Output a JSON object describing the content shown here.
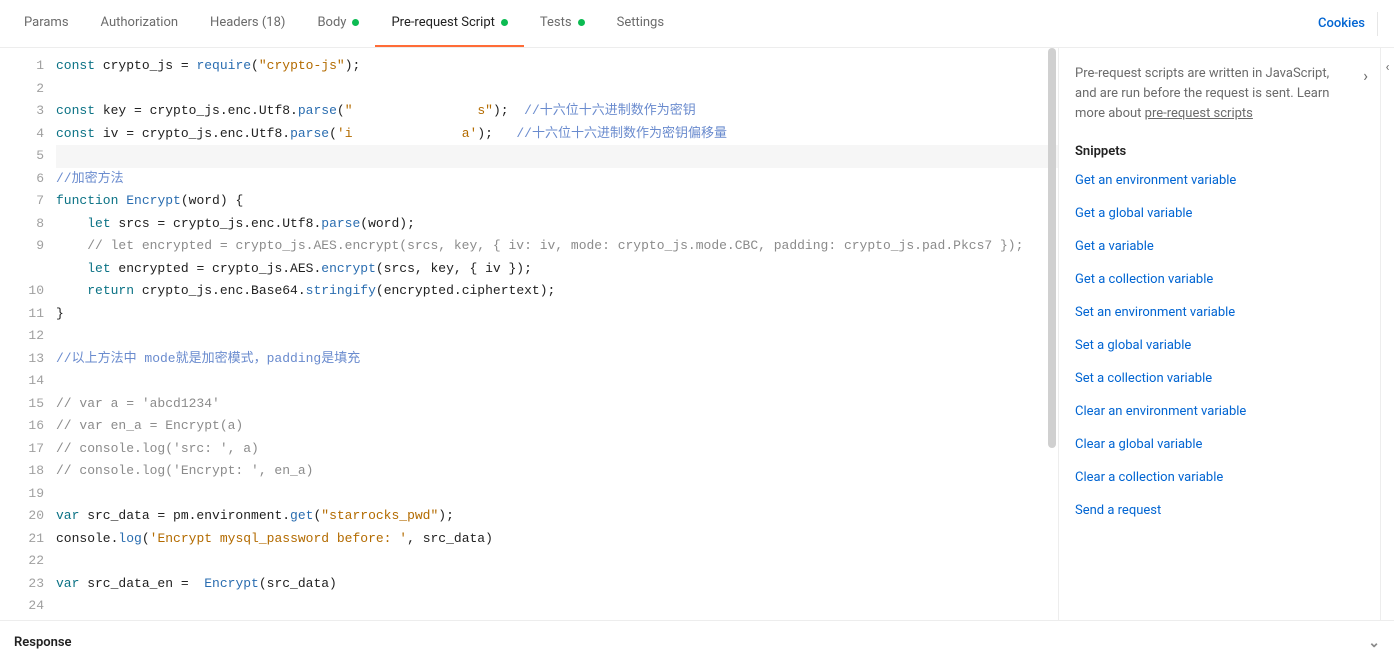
{
  "tabs": {
    "params": "Params",
    "authorization": "Authorization",
    "headers": "Headers (18)",
    "body": "Body",
    "prerequest": "Pre-request Script",
    "tests": "Tests",
    "settings": "Settings"
  },
  "cookies_label": "Cookies",
  "code": {
    "lines": [
      {
        "n": 1,
        "segs": [
          {
            "t": "const",
            "c": "kw"
          },
          {
            "t": " crypto_js = "
          },
          {
            "t": "require",
            "c": "fn"
          },
          {
            "t": "("
          },
          {
            "t": "\"crypto-js\"",
            "c": "str"
          },
          {
            "t": ");"
          }
        ]
      },
      {
        "n": 2,
        "segs": []
      },
      {
        "n": 3,
        "segs": [
          {
            "t": "const",
            "c": "kw"
          },
          {
            "t": " key = crypto_js.enc.Utf8."
          },
          {
            "t": "parse",
            "c": "fn"
          },
          {
            "t": "("
          },
          {
            "t": "\"",
            "c": "str"
          },
          {
            "t": "                s\"",
            "c": "str"
          },
          {
            "t": ");  "
          },
          {
            "t": "//十六位十六进制数作为密钥",
            "c": "cmt-cn"
          }
        ]
      },
      {
        "n": 4,
        "segs": [
          {
            "t": "const",
            "c": "kw"
          },
          {
            "t": " iv = crypto_js.enc.Utf8."
          },
          {
            "t": "parse",
            "c": "fn"
          },
          {
            "t": "("
          },
          {
            "t": "'i",
            "c": "str"
          },
          {
            "t": "              a'",
            "c": "str"
          },
          {
            "t": ");   "
          },
          {
            "t": "//十六位十六进制数作为密钥偏移量",
            "c": "cmt-cn"
          }
        ]
      },
      {
        "n": 5,
        "segs": [],
        "hl": true
      },
      {
        "n": 6,
        "segs": [
          {
            "t": "//加密方法",
            "c": "cmt-cn"
          }
        ]
      },
      {
        "n": 7,
        "segs": [
          {
            "t": "function",
            "c": "kw"
          },
          {
            "t": " "
          },
          {
            "t": "Encrypt",
            "c": "fn"
          },
          {
            "t": "(word) {"
          }
        ]
      },
      {
        "n": 8,
        "segs": [
          {
            "t": "    "
          },
          {
            "t": "let",
            "c": "kw"
          },
          {
            "t": " srcs = crypto_js.enc.Utf8."
          },
          {
            "t": "parse",
            "c": "fn"
          },
          {
            "t": "(word);"
          }
        ]
      },
      {
        "n": 9,
        "wrap": true,
        "segs": [
          {
            "t": "    "
          },
          {
            "t": "// let encrypted = crypto_js.AES.encrypt(srcs, key, { iv: iv, mode: crypto_js.mode.CBC, padding: crypto_js.pad.Pkcs7 });",
            "c": "cmt"
          }
        ]
      },
      {
        "n": 10,
        "segs": [
          {
            "t": "    "
          },
          {
            "t": "let",
            "c": "kw"
          },
          {
            "t": " encrypted = crypto_js.AES."
          },
          {
            "t": "encrypt",
            "c": "fn"
          },
          {
            "t": "(srcs, key, { iv });"
          }
        ]
      },
      {
        "n": 11,
        "segs": [
          {
            "t": "    "
          },
          {
            "t": "return",
            "c": "kw"
          },
          {
            "t": " crypto_js.enc.Base64."
          },
          {
            "t": "stringify",
            "c": "fn"
          },
          {
            "t": "(encrypted.ciphertext);"
          }
        ]
      },
      {
        "n": 12,
        "segs": [
          {
            "t": "}"
          }
        ]
      },
      {
        "n": 13,
        "segs": []
      },
      {
        "n": 14,
        "segs": [
          {
            "t": "//以上方法中 mode就是加密模式，padding是填充",
            "c": "cmt-cn"
          }
        ]
      },
      {
        "n": 15,
        "segs": []
      },
      {
        "n": 16,
        "segs": [
          {
            "t": "// var a = 'abcd1234'",
            "c": "cmt"
          }
        ]
      },
      {
        "n": 17,
        "segs": [
          {
            "t": "// var en_a = Encrypt(a)",
            "c": "cmt"
          }
        ]
      },
      {
        "n": 18,
        "segs": [
          {
            "t": "// console.log('src: ', a)",
            "c": "cmt"
          }
        ]
      },
      {
        "n": 19,
        "segs": [
          {
            "t": "// console.log('Encrypt: ', en_a)",
            "c": "cmt"
          }
        ]
      },
      {
        "n": 20,
        "segs": []
      },
      {
        "n": 21,
        "segs": [
          {
            "t": "var",
            "c": "kw"
          },
          {
            "t": " src_data = pm.environment."
          },
          {
            "t": "get",
            "c": "fn"
          },
          {
            "t": "("
          },
          {
            "t": "\"starrocks_pwd\"",
            "c": "str"
          },
          {
            "t": ");"
          }
        ]
      },
      {
        "n": 22,
        "segs": [
          {
            "t": "console."
          },
          {
            "t": "log",
            "c": "fn"
          },
          {
            "t": "("
          },
          {
            "t": "'Encrypt mysql_password before: '",
            "c": "str"
          },
          {
            "t": ", src_data)"
          }
        ]
      },
      {
        "n": 23,
        "segs": []
      },
      {
        "n": 24,
        "segs": [
          {
            "t": "var",
            "c": "kw"
          },
          {
            "t": " src_data_en =  "
          },
          {
            "t": "Encrypt",
            "c": "fn"
          },
          {
            "t": "(src_data)"
          }
        ]
      }
    ]
  },
  "side": {
    "desc_pre": "Pre-request scripts are written in JavaScript, and are run before the request is sent. Learn more about ",
    "desc_link": "pre-request scripts",
    "snippets_heading": "Snippets",
    "snippets": [
      "Get an environment variable",
      "Get a global variable",
      "Get a variable",
      "Get a collection variable",
      "Set an environment variable",
      "Set a global variable",
      "Set a collection variable",
      "Clear an environment variable",
      "Clear a global variable",
      "Clear a collection variable",
      "Send a request"
    ]
  },
  "response_label": "Response"
}
